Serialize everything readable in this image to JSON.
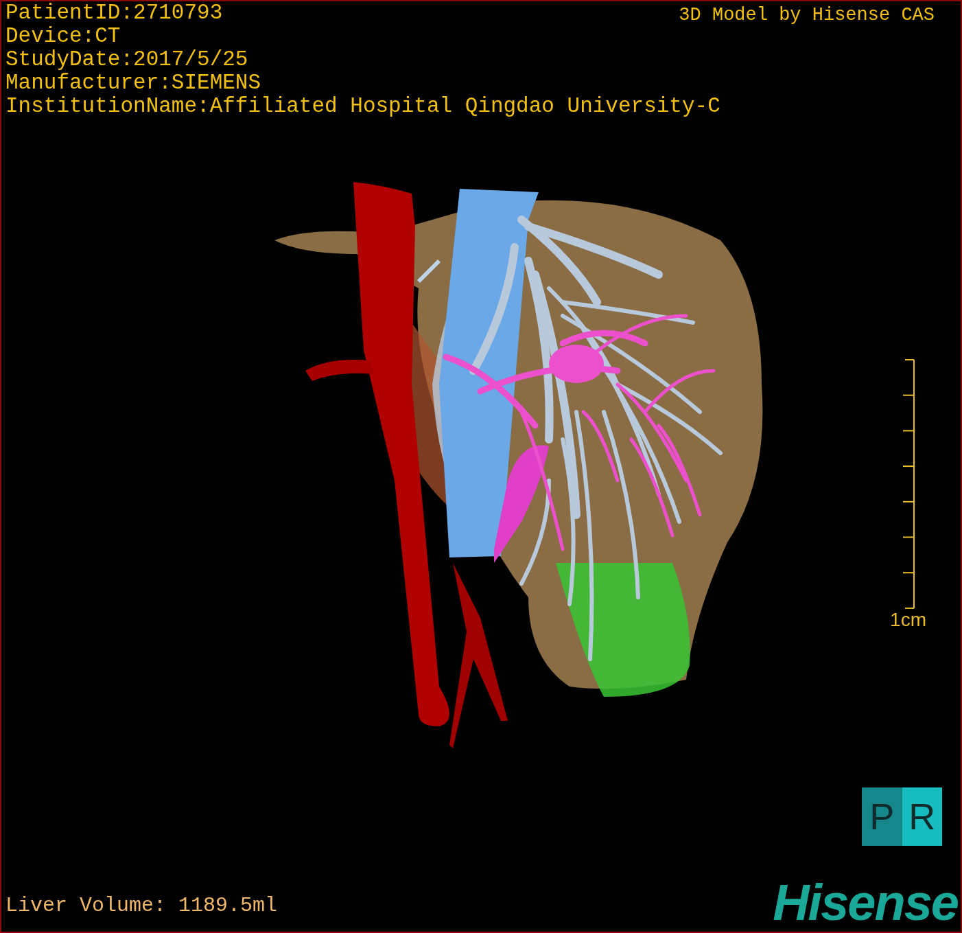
{
  "info_lines": [
    "PatientID:2710793",
    "Device:CT",
    "StudyDate:2017/5/25",
    "Manufacturer:SIEMENS",
    "InstitutionName:Affiliated Hospital Qingdao University-C"
  ],
  "credit": "3D Model by Hisense CAS",
  "scale_bar": {
    "label": "1cm"
  },
  "view_toggle": {
    "letters": [
      "P",
      "R"
    ]
  },
  "liver_volume": "Liver Volume: 1189.5ml",
  "logo": "Hisense"
}
